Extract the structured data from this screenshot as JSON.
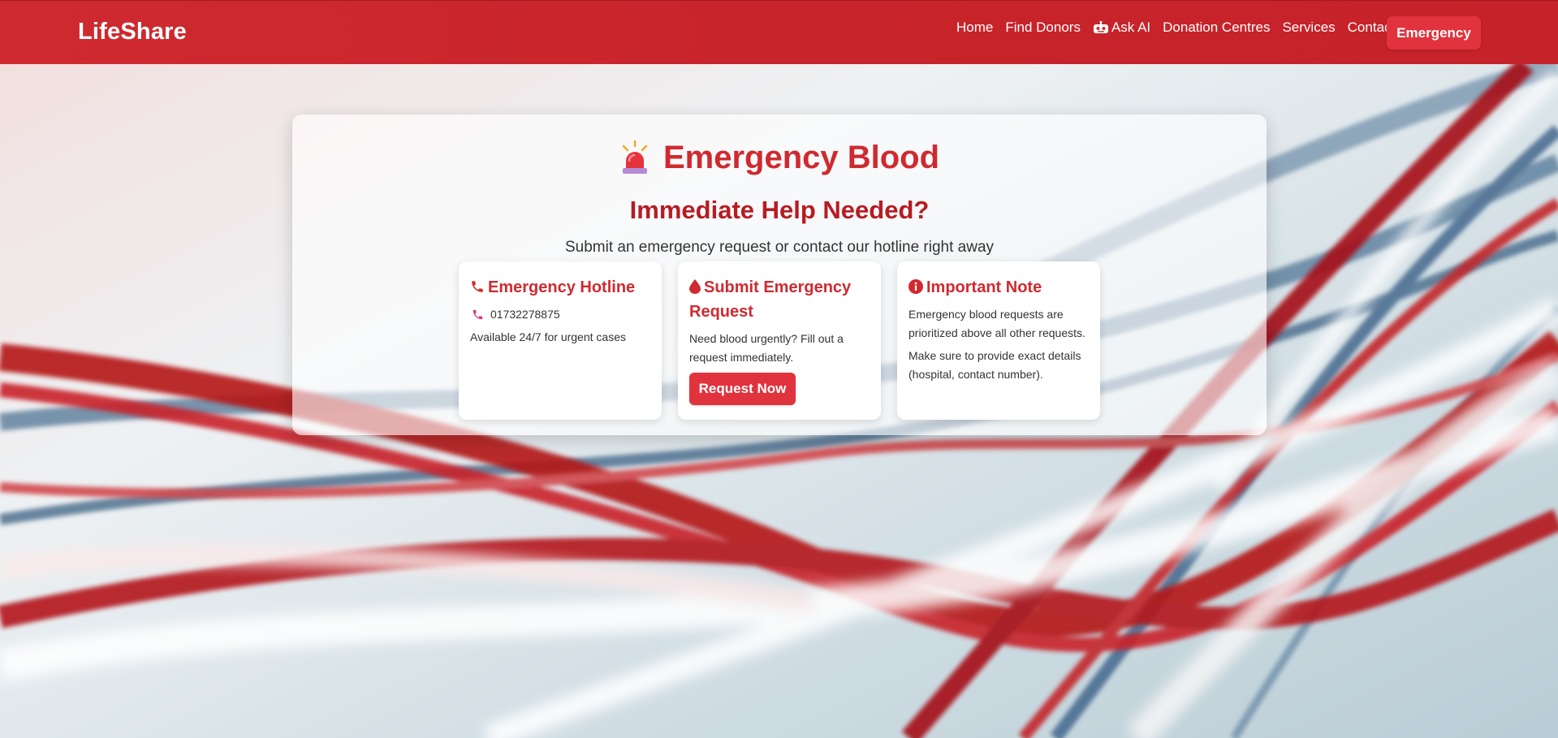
{
  "colors": {
    "brand_red": "#cf2a30",
    "button_red": "#e1333d",
    "dark_red": "#b71c22",
    "text_dark": "#333333"
  },
  "navbar": {
    "brand": "LifeShare",
    "links": [
      {
        "label": "Home"
      },
      {
        "label": "Find Donors"
      },
      {
        "label": "Ask AI",
        "icon": "robot-icon"
      },
      {
        "label": "Donation Centres"
      },
      {
        "label": "Services"
      },
      {
        "label": "Contact"
      }
    ],
    "emergency_label": "Emergency"
  },
  "hero": {
    "icon": "siren-icon",
    "title": "Emergency Blood",
    "subtitle": "Immediate Help Needed?",
    "lead": "Submit an emergency request or contact our hotline right away"
  },
  "cards": {
    "hotline": {
      "icon": "phone-icon",
      "title": "Emergency Hotline",
      "number": "01732278875",
      "availability": "Available 24/7 for urgent cases"
    },
    "request": {
      "icon": "blood-drop-icon",
      "title": "Submit Emergency Request",
      "text": "Need blood urgently? Fill out a request immediately.",
      "button_label": "Request Now"
    },
    "note": {
      "icon": "info-icon",
      "title": "Important Note",
      "text1": "Emergency blood requests are prioritized above all other requests.",
      "text2": "Make sure to provide exact details (hospital, contact number)."
    }
  }
}
